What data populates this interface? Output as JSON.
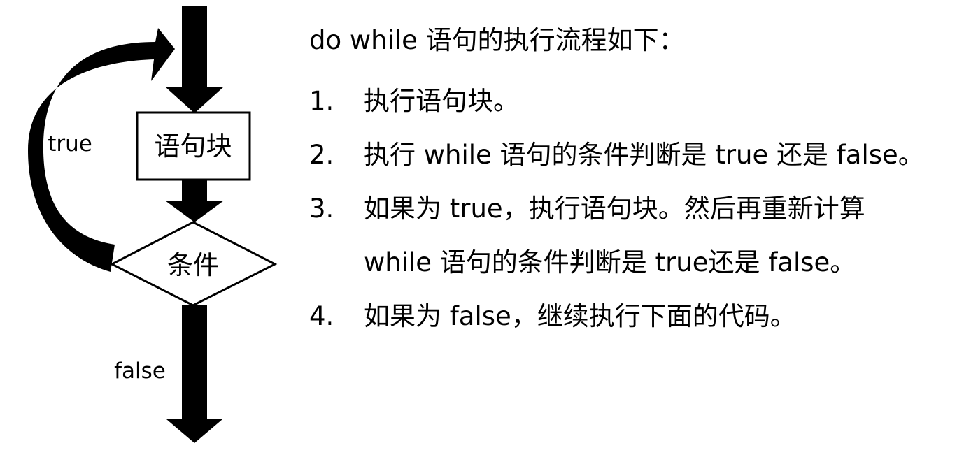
{
  "diagram": {
    "process_box": "语句块",
    "condition_box": "条件",
    "true_label": "true",
    "false_label": "false"
  },
  "description": {
    "title": "do while 语句的执行流程如下：",
    "steps": [
      {
        "num": "1.",
        "lines": [
          "执行语句块。"
        ]
      },
      {
        "num": "2.",
        "lines": [
          "执行 while 语句的条件判断是 true 还是 false。"
        ]
      },
      {
        "num": "3.",
        "lines": [
          "如果为 true，执行语句块。然后再重新计算",
          "while 语句的条件判断是 true还是 false。"
        ]
      },
      {
        "num": "4.",
        "lines": [
          "如果为 false，继续执行下面的代码。"
        ]
      }
    ]
  }
}
